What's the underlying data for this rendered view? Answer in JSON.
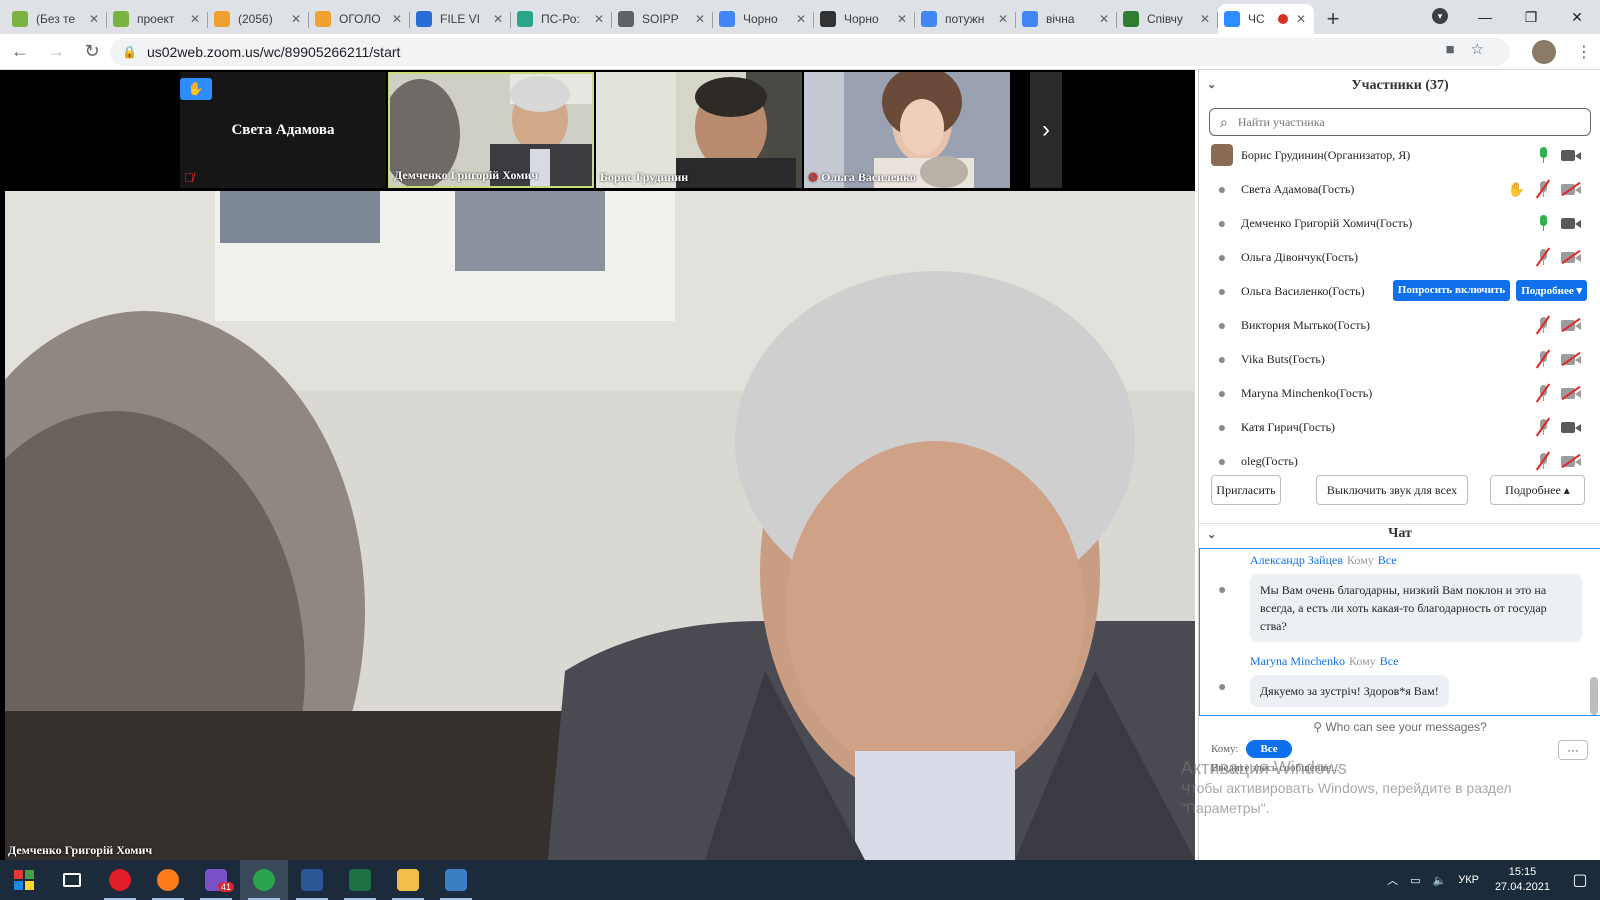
{
  "browser": {
    "tabs": [
      {
        "title": "(Без те",
        "icon": "gmail-icon",
        "color": "#7bb342"
      },
      {
        "title": "проект",
        "icon": "gmail-icon",
        "color": "#7bb342"
      },
      {
        "title": "(2056)",
        "icon": "sheets-icon",
        "color": "#f0a030"
      },
      {
        "title": "ОГОЛО",
        "icon": "sheets-icon",
        "color": "#f0a030"
      },
      {
        "title": "FILE VI",
        "icon": "docs-icon",
        "color": "#2a6dd6"
      },
      {
        "title": "ПС-Ро:",
        "icon": "chart-icon",
        "color": "#2aa58a"
      },
      {
        "title": "SOIPP",
        "icon": "globe-icon",
        "color": "#5f6368"
      },
      {
        "title": "Чорно",
        "icon": "google-icon",
        "color": "#4285f4"
      },
      {
        "title": "Чорно",
        "icon": "wikipedia-icon",
        "color": "#333333"
      },
      {
        "title": "потужн",
        "icon": "google-icon",
        "color": "#4285f4"
      },
      {
        "title": "вічна",
        "icon": "google-icon",
        "color": "#4285f4"
      },
      {
        "title": "Співчу",
        "icon": "shield-icon",
        "color": "#2e7d32"
      },
      {
        "title": "ЧС",
        "icon": "zoom-icon",
        "color": "#2d8cff",
        "active": true
      }
    ],
    "url": "us02web.zoom.us/wc/89905266211/start"
  },
  "video": {
    "thumbnails": [
      {
        "name": "Света Адамова",
        "hand_raised": true,
        "muted": true,
        "video": false
      },
      {
        "name": "Демченко Григорій Хомич",
        "active": true,
        "muted": false
      },
      {
        "name": "Борис Грудинин",
        "muted": false
      },
      {
        "name": "Ольга Василенко",
        "muted": true
      }
    ],
    "main_speaker": "Демченко Григорій Хомич"
  },
  "participants": {
    "title": "Участники (37)",
    "search_placeholder": "Найти участника",
    "rows": [
      {
        "name": "Борис Грудинин(Организатор, Я)",
        "mic": "on",
        "cam": "on",
        "avatar": "photo"
      },
      {
        "name": "Света Адамова(Гость)",
        "mic": "off",
        "cam": "off",
        "hand": true
      },
      {
        "name": "Демченко Григорій Хомич(Гость)",
        "mic": "on",
        "cam": "on"
      },
      {
        "name": "Ольга Дівончук(Гость)",
        "mic": "off",
        "cam": "off"
      },
      {
        "name": "Ольга Василенко(Гость)",
        "actions": [
          "Попросить включить",
          "Подробнее ▾"
        ]
      },
      {
        "name": "Виктория Мытько(Гость)",
        "mic": "off",
        "cam": "off"
      },
      {
        "name": "Vika Buts(Гость)",
        "mic": "off",
        "cam": "off"
      },
      {
        "name": "Maryna Minchenko(Гость)",
        "mic": "off",
        "cam": "off"
      },
      {
        "name": "Катя Гирич(Гость)",
        "mic": "off",
        "cam": "on"
      },
      {
        "name": "oleg(Гость)",
        "mic": "off",
        "cam": "off"
      }
    ],
    "invite_label": "Пригласить",
    "mute_all_label": "Выключить звук для всех",
    "more_label": "Подробнее ▴"
  },
  "chat": {
    "title": "Чат",
    "to_word": "Кому",
    "messages": [
      {
        "sender": "Александр Зайцев",
        "to": "Все",
        "text": "Мы Вам очень благодарны, низкий Вам поклон и это на всегда, а есть ли хоть какая-то благодарность от государ ства?"
      },
      {
        "sender": "Maryna Minchenko",
        "to": "Все",
        "text": "Дякуемо за зустріч! Здоров*я Вам!"
      }
    ],
    "who_can_see": "Who can see your messages?",
    "to_label": "Кому:",
    "to_value": "Все",
    "input_placeholder": "Введите здесь сообщение...",
    "more_button": "···"
  },
  "watermark": {
    "line1": "Активация Windows",
    "line2": "Чтобы активировать Windows, перейдите в раздел",
    "line3": "\"Параметры\"."
  },
  "taskbar": {
    "items": [
      {
        "name": "start-icon",
        "color": "#1e88e5"
      },
      {
        "name": "task-view-icon",
        "color": "#ffffff"
      },
      {
        "name": "opera-icon",
        "color": "#e01e2a"
      },
      {
        "name": "firefox-icon",
        "color": "#ff7a1a"
      },
      {
        "name": "viber-icon",
        "color": "#7b51c8",
        "badge": "41"
      },
      {
        "name": "chrome-icon",
        "color": "#2ba24c",
        "active": true
      },
      {
        "name": "word-icon",
        "color": "#2b5797"
      },
      {
        "name": "excel-icon",
        "color": "#1e7145"
      },
      {
        "name": "explorer-icon",
        "color": "#f2c04a"
      },
      {
        "name": "photos-icon",
        "color": "#3a7fc1"
      }
    ],
    "lang": "УКР",
    "time": "15:15",
    "date": "27.04.2021"
  }
}
